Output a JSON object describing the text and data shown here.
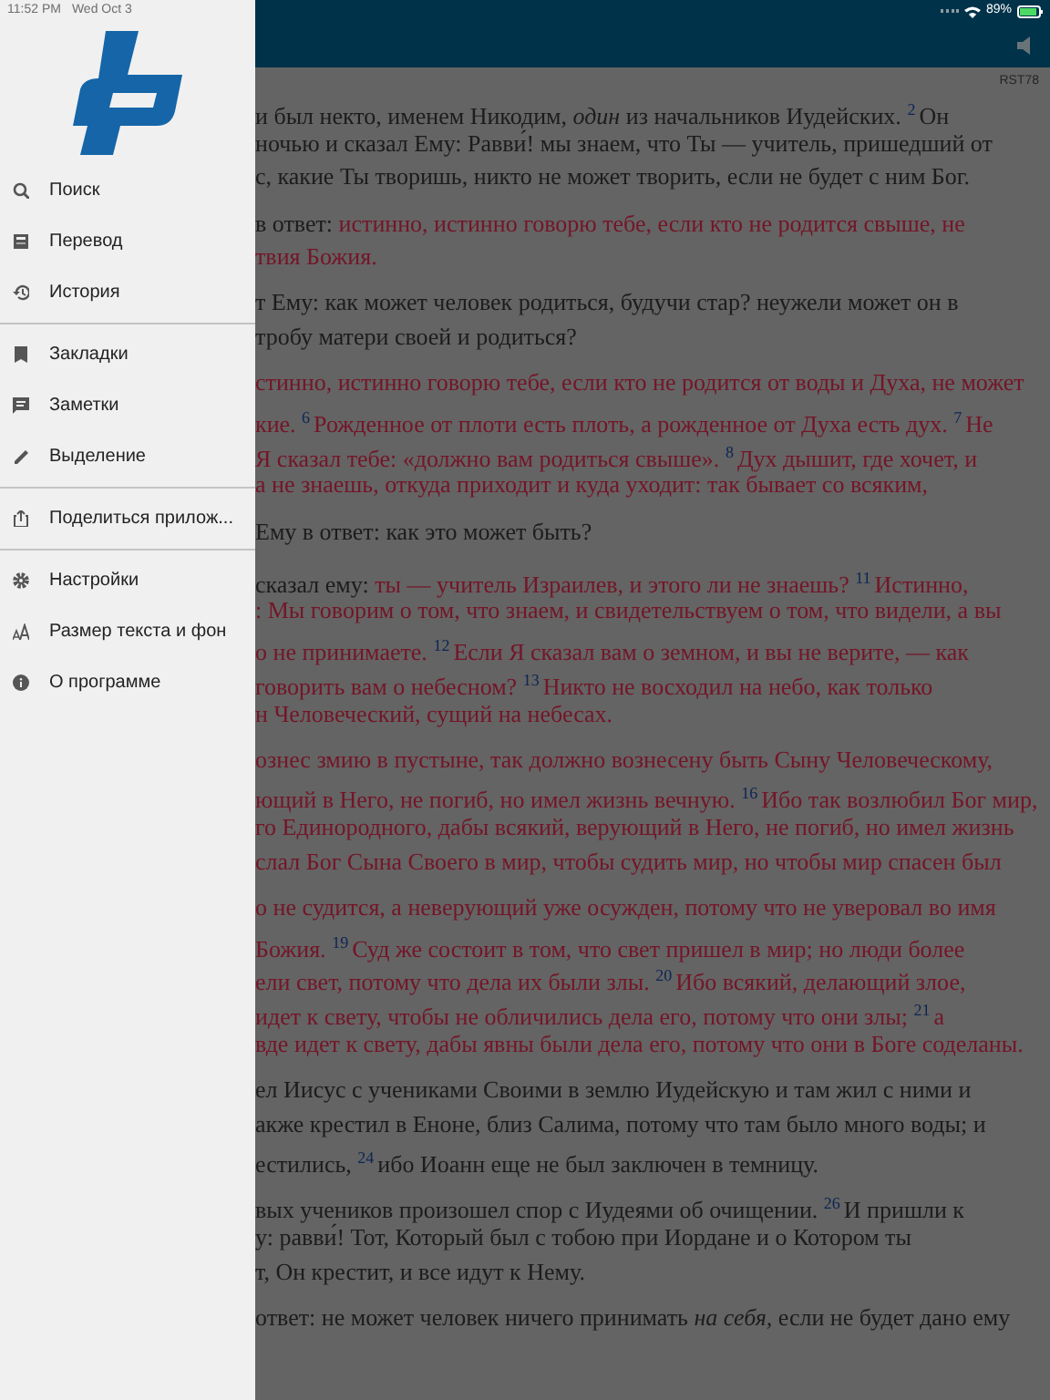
{
  "status_bar": {
    "time": "11:52 PM",
    "date": "Wed Oct 3",
    "battery": "89%"
  },
  "drawer": {
    "menu_groups": [
      [
        {
          "label": "Поиск"
        },
        {
          "label": "Перевод"
        },
        {
          "label": "История"
        }
      ],
      [
        {
          "label": "Закладки"
        },
        {
          "label": "Заметки"
        },
        {
          "label": "Выделение"
        }
      ],
      [
        {
          "label": "Поделиться прилож..."
        }
      ],
      [
        {
          "label": "Настройки"
        },
        {
          "label": "Размер текста и фон"
        },
        {
          "label": "О программе"
        }
      ]
    ]
  },
  "reader": {
    "translation": "RST78",
    "paragraphs": [
      [
        [
          {
            "kind": "text",
            "text": "и был некто, именем Никодим, *один* из начальников Иудейских. "
          },
          {
            "kind": "verse",
            "text": "2"
          },
          {
            "kind": "text",
            "text": "Он"
          }
        ],
        [
          {
            "kind": "text",
            "text": "ночью и сказал Ему: Равви́! мы знаем, что Ты — учитель, пришедший от"
          }
        ],
        [
          {
            "kind": "text",
            "text": "с, какие Ты творишь, никто не может творить, если не будет с ним Бог."
          }
        ]
      ],
      [
        [
          {
            "kind": "text",
            "text": "в ответ: "
          },
          {
            "kind": "red",
            "text": "истинно, истинно говорю тебе, если кто не родится свыше, не"
          }
        ],
        [
          {
            "kind": "red",
            "text": "твия Божия."
          }
        ]
      ],
      [
        [
          {
            "kind": "text",
            "text": "т Ему: как может человек родиться, будучи стар? неужели может он в"
          }
        ],
        [
          {
            "kind": "text",
            "text": "тробу матери своей и родиться?"
          }
        ]
      ],
      [
        [
          {
            "kind": "red",
            "text": "стинно, истинно говорю тебе, если кто не родится от воды и Духа, не может"
          }
        ],
        [
          {
            "kind": "red",
            "text": "кие. "
          },
          {
            "kind": "verse",
            "text": "6"
          },
          {
            "kind": "red",
            "text": "Рожденное от плоти есть плоть, а рожденное от Духа есть дух. "
          },
          {
            "kind": "verse",
            "text": "7"
          },
          {
            "kind": "red",
            "text": "Не"
          }
        ],
        [
          {
            "kind": "red",
            "text": "Я сказал тебе: «должно вам родиться свыше». "
          },
          {
            "kind": "verse",
            "text": "8"
          },
          {
            "kind": "red",
            "text": "Дух дышит, где хочет, и"
          }
        ],
        [
          {
            "kind": "red",
            "text": "а не знаешь, откуда приходит и куда уходит: так бывает со всяким,"
          }
        ]
      ],
      [
        [
          {
            "kind": "text",
            "text": "Ему в ответ: как это может быть?"
          }
        ]
      ],
      [
        [
          {
            "kind": "text",
            "text": "сказал ему: "
          },
          {
            "kind": "red",
            "text": "ты — учитель Израилев, и этого ли не знаешь? "
          },
          {
            "kind": "verse",
            "text": "11"
          },
          {
            "kind": "red",
            "text": "Истинно,"
          }
        ],
        [
          {
            "kind": "red",
            "text": ": Мы говорим о том, что знаем, и свидетельствуем о том, что видели, а вы"
          }
        ],
        [
          {
            "kind": "red",
            "text": "о не принимаете. "
          },
          {
            "kind": "verse",
            "text": "12"
          },
          {
            "kind": "red",
            "text": "Если Я сказал вам о земном, и вы не верите, — как"
          }
        ],
        [
          {
            "kind": "red",
            "text": "говорить вам о небесном? "
          },
          {
            "kind": "verse",
            "text": "13"
          },
          {
            "kind": "red",
            "text": "Никто не восходил на небо, как только"
          }
        ],
        [
          {
            "kind": "red",
            "text": "н Человеческий, сущий на небесах."
          }
        ]
      ],
      [
        [
          {
            "kind": "red",
            "text": "ознес змию в пустыне, так должно вознесену быть Сыну Человеческому,"
          }
        ],
        [
          {
            "kind": "red",
            "text": "ющий в Него, не погиб, но имел жизнь вечную. "
          },
          {
            "kind": "verse",
            "text": "16"
          },
          {
            "kind": "red",
            "text": "Ибо так возлюбил Бог мир,"
          }
        ],
        [
          {
            "kind": "red",
            "text": "го Единородного, дабы всякий, верующий в Него, не погиб, но имел жизнь"
          }
        ],
        [
          {
            "kind": "red",
            "text": "слал Бог Сына Своего в мир, чтобы судить мир, но чтобы мир спасен был"
          }
        ]
      ],
      [
        [
          {
            "kind": "red",
            "text": "о не судится, а неверующий уже осужден, потому что не уверовал во имя"
          }
        ],
        [
          {
            "kind": "red",
            "text": "Божия. "
          },
          {
            "kind": "verse",
            "text": "19"
          },
          {
            "kind": "red",
            "text": "Суд же состоит в том, что свет пришел в мир; но люди более"
          }
        ],
        [
          {
            "kind": "red",
            "text": "ели свет, потому что дела их были злы. "
          },
          {
            "kind": "verse",
            "text": "20"
          },
          {
            "kind": "red",
            "text": "Ибо всякий, делающий злое,"
          }
        ],
        [
          {
            "kind": "red",
            "text": "идет к свету, чтобы не обличились дела его, потому что они злы; "
          },
          {
            "kind": "verse",
            "text": "21"
          },
          {
            "kind": "red",
            "text": "а"
          }
        ],
        [
          {
            "kind": "red",
            "text": "вде идет к свету, дабы явны были дела его, потому что они в Боге соделаны."
          }
        ]
      ],
      [
        [
          {
            "kind": "text",
            "text": "ел Иисус с учениками Своими в землю Иудейскую и там жил с ними и"
          }
        ],
        [
          {
            "kind": "text",
            "text": "акже крестил в Еноне, близ Салима, потому что там было много воды; и"
          }
        ],
        [
          {
            "kind": "text",
            "text": "естились, "
          },
          {
            "kind": "verse",
            "text": "24"
          },
          {
            "kind": "text",
            "text": "ибо Иоанн еще не был заключен в темницу."
          }
        ]
      ],
      [
        [
          {
            "kind": "text",
            "text": "вых учеников произошел спор с Иудеями об очищении. "
          },
          {
            "kind": "verse",
            "text": "26"
          },
          {
            "kind": "text",
            "text": "И пришли к"
          }
        ],
        [
          {
            "kind": "text",
            "text": "у: равви́! Тот, Который был с тобою при Иордане и о Котором ты"
          }
        ],
        [
          {
            "kind": "text",
            "text": "т, Он крестит, и все идут к Нему."
          }
        ]
      ],
      [
        [
          {
            "kind": "text",
            "text": "ответ: не может человек ничего принимать *на себя,* если не будет дано ему"
          }
        ]
      ]
    ]
  }
}
